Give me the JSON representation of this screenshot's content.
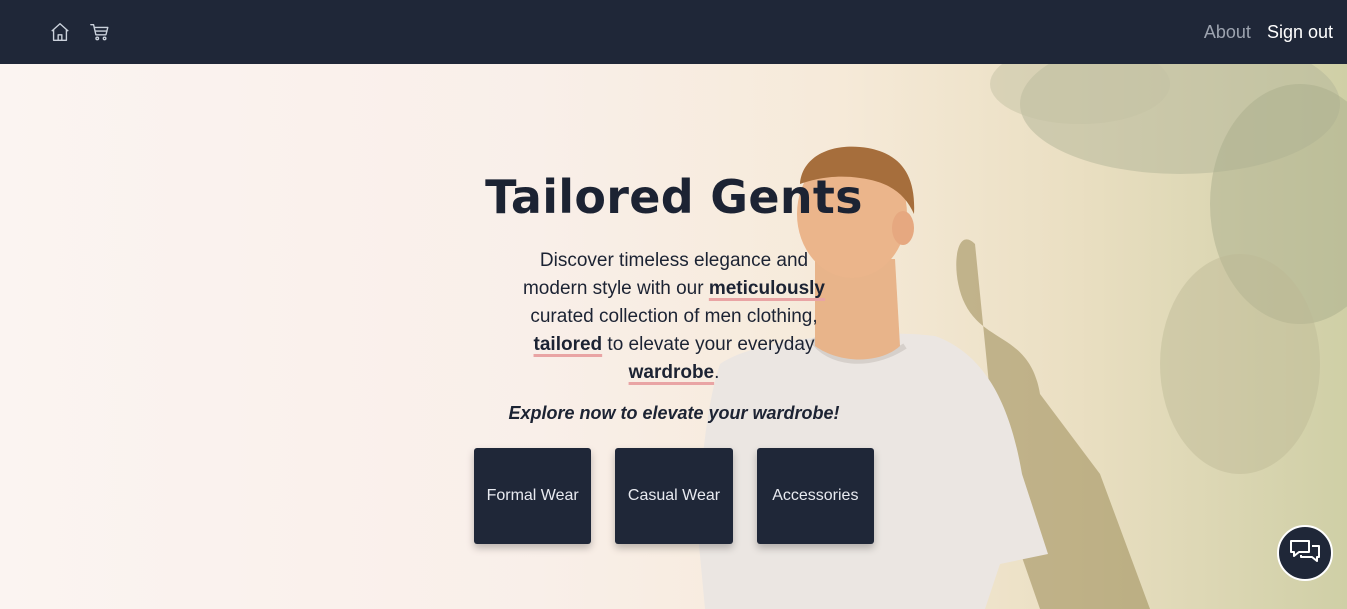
{
  "nav": {
    "icons": [
      "home-icon",
      "cart-icon"
    ],
    "links": [
      {
        "label": "About"
      },
      {
        "label": "Sign out"
      }
    ]
  },
  "hero": {
    "title": "Tailored Gents",
    "description": {
      "p1": "Discover timeless elegance and modern style with our ",
      "b1": "meticulously",
      "p2": " curated collection of men clothing, ",
      "b2": "tailored",
      "p3": " to elevate your everyday ",
      "b3": "wardrobe",
      "p4": "."
    },
    "cta": "Explore now to elevate your wardrobe!",
    "categories": [
      "Formal Wear",
      "Casual Wear",
      "Accessories"
    ]
  },
  "chat": {
    "icon": "chat-icon"
  },
  "colors": {
    "navbar": "#1f2738",
    "accent": "#e9a4a4",
    "text": "#1c2333"
  }
}
